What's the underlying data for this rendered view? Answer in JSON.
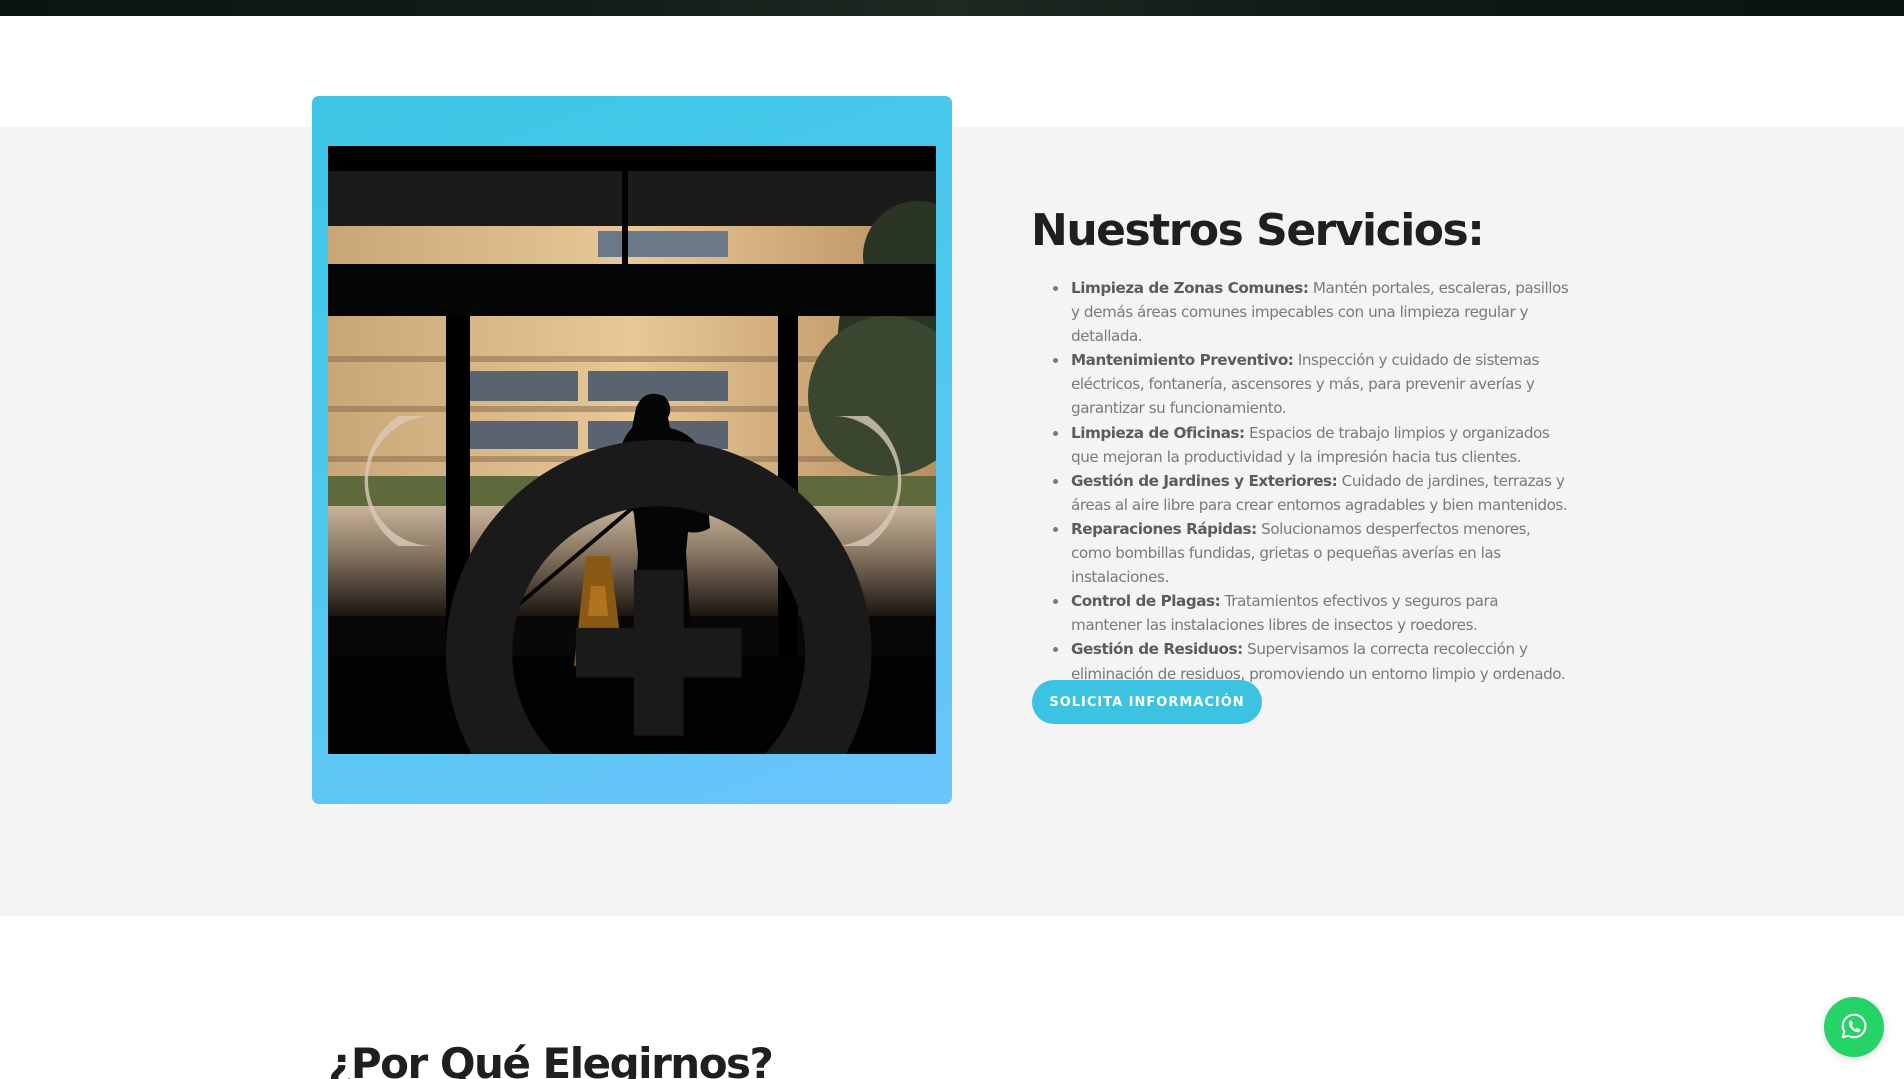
{
  "services": {
    "title": "Nuestros Servicios:",
    "items": [
      {
        "name": "Limpieza de Zonas Comunes:",
        "text": " Mantén portales, escaleras, pasillos y demás áreas comunes impecables con una limpieza regular y detallada."
      },
      {
        "name": "Mantenimiento Preventivo:",
        "text": " Inspección y cuidado de sistemas eléctricos, fontanería, ascensores y más, para prevenir averías y garantizar su funcionamiento."
      },
      {
        "name": "Limpieza de Oficinas:",
        "text": " Espacios de trabajo limpios y organizados que mejoran la productividad y la impresión hacia tus clientes."
      },
      {
        "name": "Gestión de Jardines y Exteriores:",
        "text": " Cuidado de jardines, terrazas y áreas al aire libre para crear entornos agradables y bien mantenidos."
      },
      {
        "name": "Reparaciones Rápidas:",
        "text": " Solucionamos desperfectos menores, como bombillas fundidas, grietas o pequeñas averías en las instalaciones."
      },
      {
        "name": "Control de Plagas:",
        "text": " Tratamientos efectivos y seguros para mantener las instalaciones libres de insectos y roedores."
      },
      {
        "name": "Gestión de Residuos:",
        "text": " Supervisamos la correcta recolección y eliminación de residuos, promoviendo un entorno limpio y ordenado."
      }
    ],
    "cta_label": "SOLICITA INFORMACIÓN"
  },
  "why_us": {
    "title": "¿Por Qué Elegirnos?"
  },
  "icons": {
    "zoom": "zoom-in-icon",
    "whatsapp": "whatsapp-icon"
  },
  "colors": {
    "accent": "#3cc3e2",
    "whatsapp": "#25d366",
    "section_bg": "#f4f4f4",
    "heading": "#1f1f1f"
  }
}
